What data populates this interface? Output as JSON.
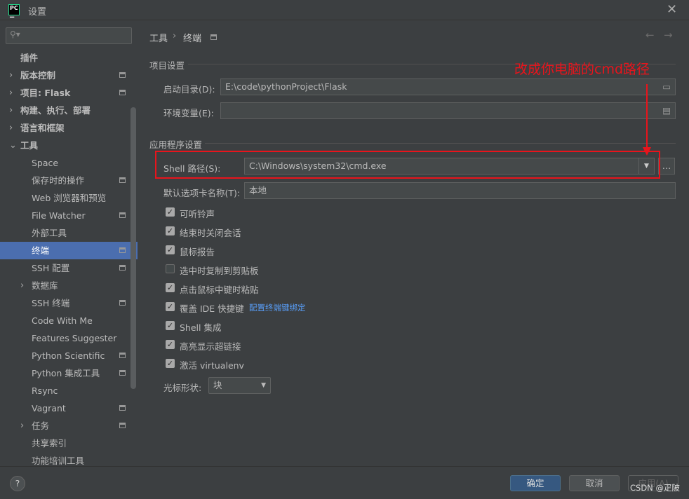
{
  "window": {
    "title": "设置",
    "logo": "PC"
  },
  "sidebar": {
    "search_placeholder": "",
    "items": [
      {
        "label": "插件",
        "level": 0,
        "arrow": ""
      },
      {
        "label": "版本控制",
        "level": 0,
        "arrow": "›",
        "pin": true
      },
      {
        "label": "项目: Flask",
        "level": 0,
        "arrow": "›",
        "pin": true
      },
      {
        "label": "构建、执行、部署",
        "level": 0,
        "arrow": "›"
      },
      {
        "label": "语言和框架",
        "level": 0,
        "arrow": "›"
      },
      {
        "label": "工具",
        "level": 0,
        "arrow": "⌄"
      },
      {
        "label": "Space",
        "level": 1
      },
      {
        "label": "保存时的操作",
        "level": 1,
        "pin": true
      },
      {
        "label": "Web 浏览器和预览",
        "level": 1
      },
      {
        "label": "File Watcher",
        "level": 1,
        "pin": true
      },
      {
        "label": "外部工具",
        "level": 1
      },
      {
        "label": "终端",
        "level": 1,
        "pin": true,
        "selected": true
      },
      {
        "label": "SSH 配置",
        "level": 1,
        "pin": true
      },
      {
        "label": "数据库",
        "level": 1,
        "arrow": "›"
      },
      {
        "label": "SSH 终端",
        "level": 1,
        "pin": true
      },
      {
        "label": "Code With Me",
        "level": 1
      },
      {
        "label": "Features Suggester",
        "level": 1
      },
      {
        "label": "Python Scientific",
        "level": 1,
        "pin": true
      },
      {
        "label": "Python 集成工具",
        "level": 1,
        "pin": true
      },
      {
        "label": "Rsync",
        "level": 1
      },
      {
        "label": "Vagrant",
        "level": 1,
        "pin": true
      },
      {
        "label": "任务",
        "level": 1,
        "arrow": "›",
        "pin": true
      },
      {
        "label": "共享索引",
        "level": 1
      },
      {
        "label": "功能培训工具",
        "level": 1
      }
    ]
  },
  "breadcrumb": {
    "parent": "工具",
    "sep": "›",
    "current": "终端"
  },
  "project_settings": {
    "title": "项目设置",
    "start_dir_label": "启动目录(D):",
    "start_dir_value": "E:\\code\\pythonProject\\Flask",
    "env_label": "环境变量(E):",
    "env_value": ""
  },
  "app_settings": {
    "title": "应用程序设置",
    "shell_label": "Shell 路径(S):",
    "shell_value": "C:\\Windows\\system32\\cmd.exe",
    "tab_name_label": "默认选项卡名称(T):",
    "tab_name_value": "本地",
    "checkboxes": [
      {
        "label": "可听铃声",
        "checked": true
      },
      {
        "label": "结束时关闭会话",
        "checked": true
      },
      {
        "label": "鼠标报告",
        "checked": true
      },
      {
        "label": "选中时复制到剪贴板",
        "checked": false
      },
      {
        "label": "点击鼠标中键时粘贴",
        "checked": true
      },
      {
        "label": "覆盖 IDE 快捷键",
        "checked": true,
        "link": "配置终端键绑定"
      },
      {
        "label": "Shell 集成",
        "checked": true
      },
      {
        "label": "高亮显示超链接",
        "checked": true
      },
      {
        "label": "激活 virtualenv",
        "checked": true
      }
    ],
    "cursor_label": "光标形状:",
    "cursor_value": "块"
  },
  "annotation": {
    "text": "改成你电脑的cmd路径",
    "color": "#e8141c"
  },
  "footer": {
    "help": "?",
    "ok": "确定",
    "cancel": "取消",
    "apply": "应用(A)",
    "watermark": "CSDN @疋陂"
  },
  "colors": {
    "accent": "#4b6eaf",
    "link": "#589df6",
    "ok_button": "#365880"
  }
}
